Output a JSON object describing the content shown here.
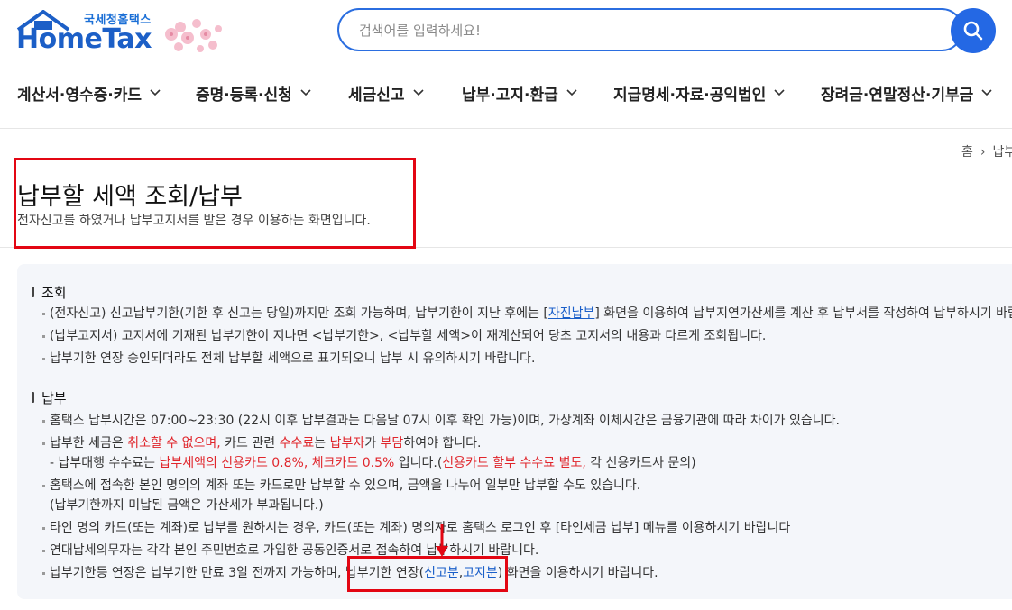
{
  "header": {
    "logo_sub": "국세청홈택스",
    "logo_main": "HomeTax",
    "search_placeholder": "검색어를 입력하세요!",
    "search_icon": "search-icon"
  },
  "nav": {
    "items": [
      {
        "label": "계산서·영수증·카드"
      },
      {
        "label": "증명·등록·신청"
      },
      {
        "label": "세금신고"
      },
      {
        "label": "납부·고지·환급"
      },
      {
        "label": "지급명세·자료·공익법인"
      },
      {
        "label": "장려금·연말정산·기부금"
      }
    ]
  },
  "breadcrumb": {
    "home": "홈",
    "current": "납부"
  },
  "page": {
    "title": "납부할 세액 조회/납부",
    "desc": "전자신고를 하였거나 납부고지서를 받은 경우 이용하는 화면입니다."
  },
  "notice": {
    "query": {
      "heading": "조회",
      "item1_a": "(전자신고) 신고납부기한(기한 후 신고는 당일)까지만 조회 가능하며, 납부기한이 지난 후에는 [",
      "item1_link": "자진납부",
      "item1_b": "] 화면을 이용하여 납부지연가산세를 계산 후 납부서를 작성하여 납부하시기 바랍니다.",
      "item2": "(납부고지서) 고지서에 기재된 납부기한이 지나면 <납부기한>, <납부할 세액>이 재계산되어 당초 고지서의 내용과 다르게 조회됩니다.",
      "item3": "납부기한 연장 승인되더라도 전체 납부할 세액으로 표기되오니 납부 시 유의하시기 바랍니다."
    },
    "pay": {
      "heading": "납부",
      "item1": "홈택스 납부시간은 07:00~23:30 (22시 이후 납부결과는 다음날 07시 이후 확인 가능)이며, 가상계좌 이체시간은 금융기관에 따라 차이가 있습니다.",
      "item2_a": "납부한 세금은 ",
      "item2_b": "취소할 수 없으며,",
      "item2_c": " 카드 관련 ",
      "item2_d": "수수료",
      "item2_e": "는 ",
      "item2_f": "납부자",
      "item2_g": "가 ",
      "item2_h": "부담",
      "item2_i": "하여야 합니다.",
      "item2_sub_a": "- 납부대행 수수료는 ",
      "item2_sub_b": "납부세액의 신용카드 0.8%, 체크카드 0.5%",
      "item2_sub_c": " 입니다.(",
      "item2_sub_d": "신용카드 할부 수수료 별도,",
      "item2_sub_e": " 각 신용카드사 문의)",
      "item3": "홈택스에 접속한 본인 명의의 계좌 또는 카드로만 납부할 수 있으며, 금액을 나누어 일부만 납부할 수도 있습니다.",
      "item3_sub": "(납부기한까지 미납된 금액은 가산세가 부과됩니다.)",
      "item4": "타인 명의 카드(또는 계좌)로 납부를 원하시는 경우, 카드(또는 계좌) 명의자로 홈택스 로그인 후 [타인세금 납부] 메뉴를 이용하시기 바랍니다",
      "item5": "연대납세의무자는 각각 본인 주민번호로 가입한 공동인증서로 접속하여 납부하시기 바랍니다.",
      "item6_a": "납부기한등 연장은 납부기한 만료 3일 전까지 가능하며, 납부기한 연장(",
      "item6_link1": "신고분",
      "item6_comma": ",",
      "item6_link2": "고지분",
      "item6_b": ") 화면을 이용하시기 바랍니다."
    }
  },
  "colors": {
    "accent": "#2468e4",
    "highlight": "#e30613",
    "red_text": "#e0262c"
  }
}
